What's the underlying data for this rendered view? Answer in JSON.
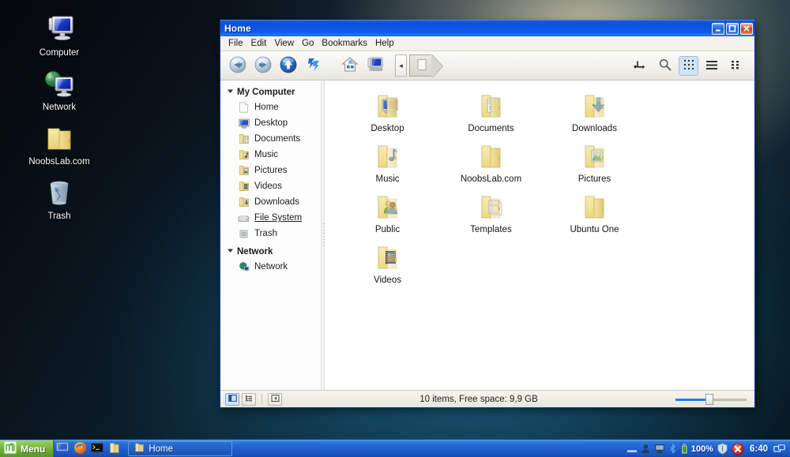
{
  "desktop": {
    "icons": [
      {
        "label": "Computer",
        "icon": "computer-icon"
      },
      {
        "label": "Network",
        "icon": "network-icon"
      },
      {
        "label": "NoobsLab.com",
        "icon": "folder-icon"
      },
      {
        "label": "Trash",
        "icon": "trash-icon"
      }
    ]
  },
  "window": {
    "title": "Home",
    "titlebar_buttons": [
      {
        "name": "minimize",
        "icon": "minimize-icon"
      },
      {
        "name": "maximize",
        "icon": "maximize-icon"
      },
      {
        "name": "close",
        "icon": "close-icon"
      }
    ],
    "menu": [
      "File",
      "Edit",
      "View",
      "Go",
      "Bookmarks",
      "Help"
    ],
    "toolbar": {
      "buttons": [
        {
          "name": "back",
          "icon": "back-arrow-icon",
          "tooltip": "Back"
        },
        {
          "name": "forward",
          "icon": "forward-arrow-icon",
          "tooltip": "Forward"
        },
        {
          "name": "up",
          "icon": "up-arrow-icon",
          "tooltip": "Up"
        },
        {
          "name": "reload",
          "icon": "reload-icon",
          "tooltip": "Reload"
        },
        {
          "name": "home",
          "icon": "home-icon",
          "tooltip": "Home"
        },
        {
          "name": "computer",
          "icon": "computer-icon",
          "tooltip": "Computer"
        }
      ],
      "right_buttons": [
        {
          "name": "open-terminal",
          "icon": "terminal-prompt-icon"
        },
        {
          "name": "search",
          "icon": "magnifier-icon"
        },
        {
          "name": "icon-view",
          "icon": "grid-view-icon",
          "active": true
        },
        {
          "name": "list-view",
          "icon": "list-view-icon",
          "active": false
        },
        {
          "name": "compact-view",
          "icon": "compact-view-icon",
          "active": false
        }
      ],
      "breadcrumb": {
        "prev_label": "◂",
        "current": "Home",
        "current_icon": "home-crumb-icon"
      }
    },
    "sidebar": {
      "groups": [
        {
          "label": "My Computer",
          "expanded": true,
          "items": [
            {
              "label": "Home",
              "icon": "page-icon"
            },
            {
              "label": "Desktop",
              "icon": "desktop-icon"
            },
            {
              "label": "Documents",
              "icon": "documents-folder-icon"
            },
            {
              "label": "Music",
              "icon": "music-folder-icon"
            },
            {
              "label": "Pictures",
              "icon": "pictures-folder-icon"
            },
            {
              "label": "Videos",
              "icon": "videos-folder-icon"
            },
            {
              "label": "Downloads",
              "icon": "downloads-folder-icon"
            },
            {
              "label": "File System",
              "icon": "drive-icon",
              "underlined": true
            },
            {
              "label": "Trash",
              "icon": "trash-small-icon"
            }
          ]
        },
        {
          "label": "Network",
          "expanded": true,
          "items": [
            {
              "label": "Network",
              "icon": "network-globe-icon"
            }
          ]
        }
      ]
    },
    "files": [
      {
        "label": "Desktop",
        "icon": "folder-desktop-icon"
      },
      {
        "label": "Documents",
        "icon": "folder-documents-icon"
      },
      {
        "label": "Downloads",
        "icon": "folder-downloads-icon"
      },
      {
        "label": "Music",
        "icon": "folder-music-icon"
      },
      {
        "label": "NoobsLab.com",
        "icon": "folder-plain-icon"
      },
      {
        "label": "Pictures",
        "icon": "folder-pictures-icon"
      },
      {
        "label": "Public",
        "icon": "folder-public-icon"
      },
      {
        "label": "Templates",
        "icon": "folder-templates-icon"
      },
      {
        "label": "Ubuntu One",
        "icon": "folder-plain-icon"
      },
      {
        "label": "Videos",
        "icon": "folder-videos-icon"
      }
    ],
    "statusbar": {
      "text": "10 items, Free space: 9,9 GB",
      "buttons": [
        {
          "name": "show-sidebar",
          "icon": "sidebar-toggle-icon",
          "selected": true
        },
        {
          "name": "show-tree",
          "icon": "tree-toggle-icon",
          "selected": false
        },
        {
          "name": "show-extra-pane",
          "icon": "extra-pane-icon",
          "selected": false
        }
      ],
      "zoom": {
        "value": 42,
        "max": 90
      }
    }
  },
  "taskbar": {
    "menu_label": "Menu",
    "menu_icon": "mint-logo-icon",
    "quick_launch": [
      {
        "name": "show-desktop",
        "icon": "show-desktop-icon"
      },
      {
        "name": "firefox",
        "icon": "firefox-icon"
      },
      {
        "name": "terminal",
        "icon": "terminal-icon"
      },
      {
        "name": "file-manager",
        "icon": "folder-icon"
      }
    ],
    "tasks": [
      {
        "label": "Home",
        "icon": "folder-icon",
        "active": true
      }
    ],
    "tray": {
      "icons": [
        {
          "name": "keyboard-tray-icon"
        },
        {
          "name": "user-tray-icon"
        },
        {
          "name": "display-tray-icon"
        },
        {
          "name": "bluetooth-tray-icon"
        },
        {
          "name": "battery-tray-icon"
        }
      ],
      "battery": "100%",
      "shield_icon": "shield-tray-icon",
      "error_icon": "error-tray-icon",
      "clock": "6:40",
      "workspace_icon": "workspace-switcher-icon"
    }
  },
  "colors": {
    "titlebar_blue": "#0c55e4",
    "taskbar_blue": "#1f5fce",
    "mint_green": "#66a832",
    "close_red": "#cc3d1c",
    "accent_select": "#cfe3f7"
  }
}
